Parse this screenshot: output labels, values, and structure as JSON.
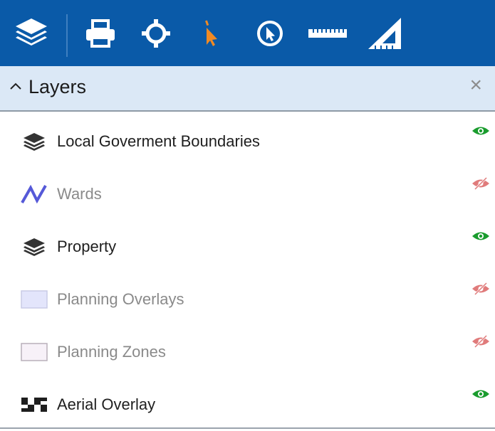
{
  "toolbar": {
    "tools": [
      {
        "name": "layers",
        "icon": "layers-icon"
      },
      {
        "name": "print",
        "icon": "print-icon"
      },
      {
        "name": "locate",
        "icon": "crosshair-icon"
      },
      {
        "name": "select",
        "icon": "pointer-icon"
      },
      {
        "name": "identify",
        "icon": "cursor-circle-icon"
      },
      {
        "name": "measure",
        "icon": "ruler-icon"
      },
      {
        "name": "area",
        "icon": "set-square-icon"
      }
    ],
    "colors": {
      "background": "#0a5aa8",
      "icon": "#ffffff",
      "active": "#f08a24"
    }
  },
  "panel": {
    "title": "Layers",
    "close_glyph": "×",
    "colors": {
      "header_bg": "#dbe8f6"
    }
  },
  "layers": [
    {
      "label": "Local Goverment Boundaries",
      "icon": "stacked-layers-icon",
      "visible": true
    },
    {
      "label": "Wards",
      "icon": "polyline-icon",
      "visible": false
    },
    {
      "label": "Property",
      "icon": "stacked-layers-icon",
      "visible": true
    },
    {
      "label": "Planning Overlays",
      "icon": "swatch-icon",
      "visible": false
    },
    {
      "label": "Planning Zones",
      "icon": "swatch-icon",
      "visible": false
    },
    {
      "label": "Aerial Overlay",
      "icon": "checker-icon",
      "visible": true
    }
  ],
  "colors": {
    "visible_eye": "#1a9c2e",
    "hidden_eye": "#e07b7b"
  }
}
